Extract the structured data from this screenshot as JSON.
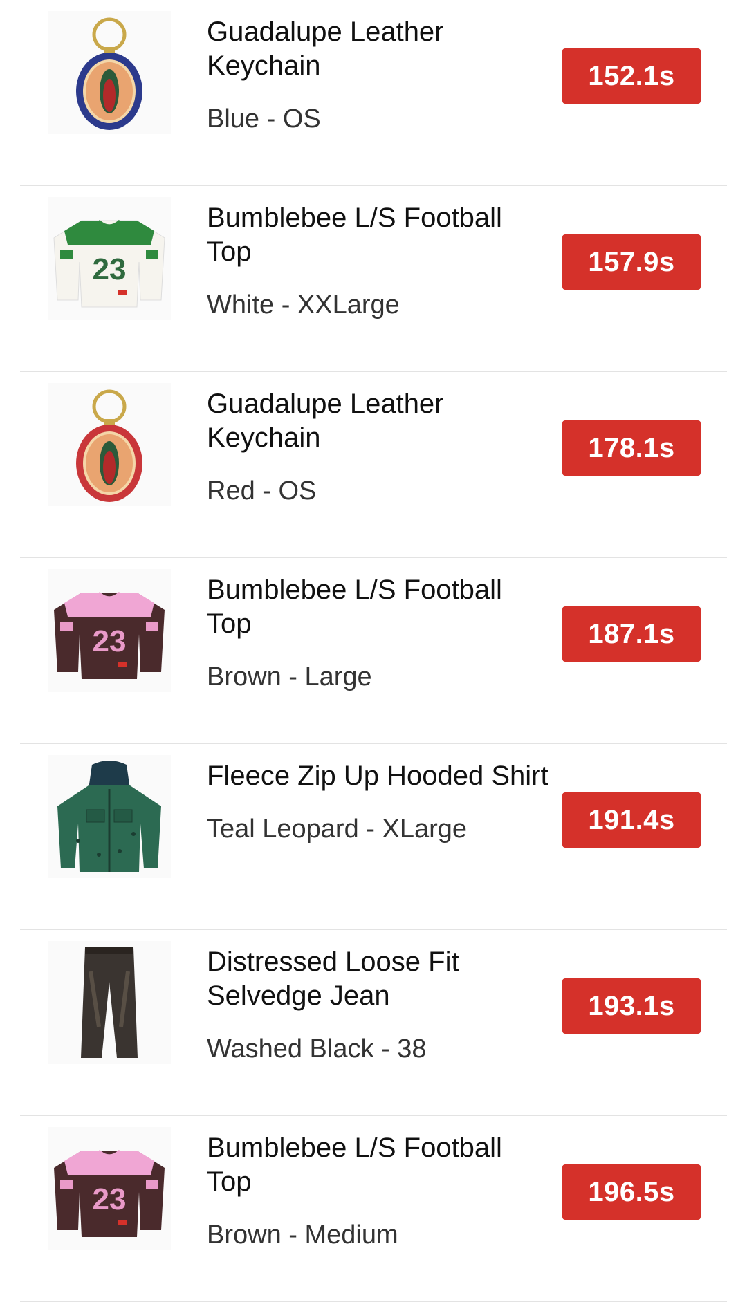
{
  "items": [
    {
      "name": "Guadalupe Leather Keychain",
      "variant": "Blue - OS",
      "time": "152.1s",
      "image": "keychain-blue-icon"
    },
    {
      "name": "Bumblebee L/S Football Top",
      "variant": "White - XXLarge",
      "time": "157.9s",
      "image": "football-top-white-icon"
    },
    {
      "name": "Guadalupe Leather Keychain",
      "variant": "Red - OS",
      "time": "178.1s",
      "image": "keychain-red-icon"
    },
    {
      "name": "Bumblebee L/S Football Top",
      "variant": "Brown - Large",
      "time": "187.1s",
      "image": "football-top-brown-icon"
    },
    {
      "name": "Fleece Zip Up Hooded Shirt",
      "variant": "Teal Leopard - XLarge",
      "time": "191.4s",
      "image": "hooded-shirt-icon"
    },
    {
      "name": "Distressed Loose Fit Selvedge Jean",
      "variant": "Washed Black - 38",
      "time": "193.1s",
      "image": "jean-icon"
    },
    {
      "name": "Bumblebee L/S Football Top",
      "variant": "Brown - Medium",
      "time": "196.5s",
      "image": "football-top-brown-icon"
    }
  ],
  "colors": {
    "badge": "#d5312a",
    "divider": "#e3e3e3"
  }
}
